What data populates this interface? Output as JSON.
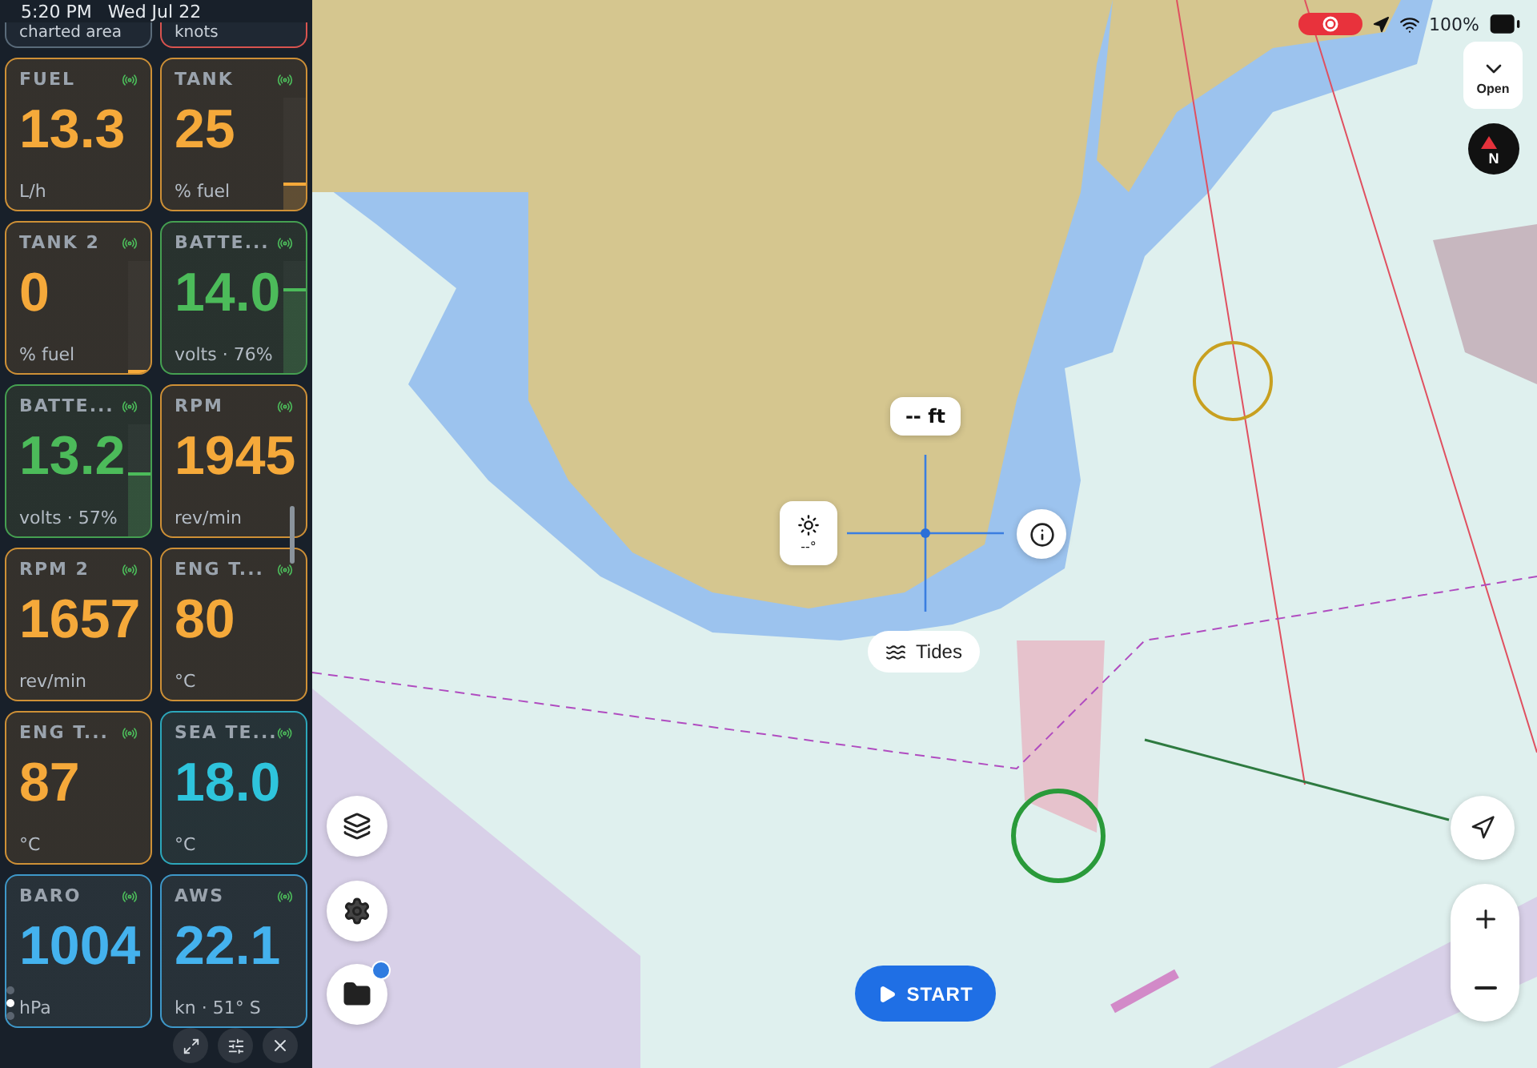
{
  "status_bar": {
    "time": "5:20 PM",
    "date": "Wed Jul 22",
    "battery": "100%"
  },
  "panel": {
    "partial_cards": [
      {
        "unit": "charted area",
        "color": "#5a6b7a"
      },
      {
        "unit": "knots",
        "color": "#d9534f"
      }
    ],
    "cards": [
      {
        "label": "FUEL",
        "value": "13.3",
        "unit": "L/h",
        "color": "#f5a93a"
      },
      {
        "label": "TANK",
        "value": "25",
        "unit": "% fuel",
        "color": "#f5a93a",
        "level": 0.25
      },
      {
        "label": "TANK 2",
        "value": "0",
        "unit": "% fuel",
        "color": "#f5a93a",
        "level": 0
      },
      {
        "label": "BATTE...",
        "value": "14.0",
        "unit": "volts · 76%",
        "color": "#4cbb5a",
        "level": 0.76
      },
      {
        "label": "BATTE...",
        "value": "13.2",
        "unit": "volts · 57%",
        "color": "#4cbb5a",
        "level": 0.57
      },
      {
        "label": "RPM",
        "value": "1945",
        "unit": "rev/min",
        "color": "#f5a93a"
      },
      {
        "label": "RPM 2",
        "value": "1657",
        "unit": "rev/min",
        "color": "#f5a93a"
      },
      {
        "label": "ENG T...",
        "value": "80",
        "unit": "°C",
        "color": "#f5a93a"
      },
      {
        "label": "ENG T...",
        "value": "87",
        "unit": "°C",
        "color": "#f5a93a"
      },
      {
        "label": "SEA TE...",
        "value": "18.0",
        "unit": "°C",
        "color": "#2ec4dc"
      },
      {
        "label": "BARO",
        "value": "1004",
        "unit": "hPa",
        "color": "#44b2ee"
      },
      {
        "label": "AWS",
        "value": "22.1",
        "unit": "kn · 51° S",
        "color": "#44b2ee"
      }
    ],
    "page_dots": [
      {
        "selected": false
      },
      {
        "selected": true
      },
      {
        "selected": false
      }
    ]
  },
  "map": {
    "depth_chip": "-- ft",
    "light_chip": "--°",
    "tides_button": "Tides",
    "open_button": "Open",
    "compass_label": "N",
    "start_button": "START",
    "account_badge": true
  }
}
